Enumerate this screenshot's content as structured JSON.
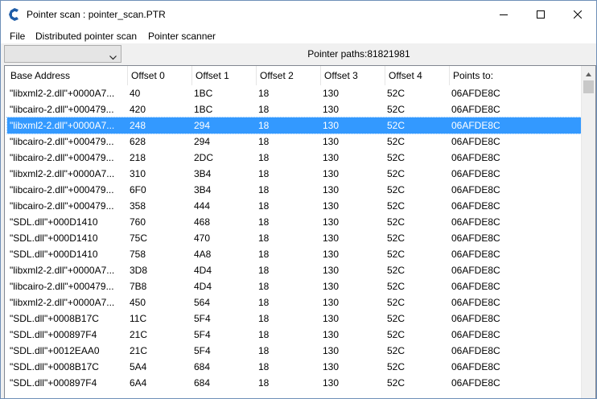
{
  "window": {
    "title": "Pointer scan : pointer_scan.PTR"
  },
  "menu": {
    "items": [
      "File",
      "Distributed pointer scan",
      "Pointer scanner"
    ]
  },
  "toolbar": {
    "combo_value": "",
    "pointer_paths": "Pointer paths:81821981"
  },
  "table": {
    "columns": [
      "Base Address",
      "Offset 0",
      "Offset 1",
      "Offset 2",
      "Offset 3",
      "Offset 4",
      "Points to:"
    ],
    "selected_index": 2,
    "rows": [
      [
        "\"libxml2-2.dll\"+0000A7...",
        "40",
        "1BC",
        "18",
        "130",
        "52C",
        "06AFDE8C"
      ],
      [
        "\"libcairo-2.dll\"+000479...",
        "420",
        "1BC",
        "18",
        "130",
        "52C",
        "06AFDE8C"
      ],
      [
        "\"libxml2-2.dll\"+0000A7...",
        "248",
        "294",
        "18",
        "130",
        "52C",
        "06AFDE8C"
      ],
      [
        "\"libcairo-2.dll\"+000479...",
        "628",
        "294",
        "18",
        "130",
        "52C",
        "06AFDE8C"
      ],
      [
        "\"libcairo-2.dll\"+000479...",
        "218",
        "2DC",
        "18",
        "130",
        "52C",
        "06AFDE8C"
      ],
      [
        "\"libxml2-2.dll\"+0000A7...",
        "310",
        "3B4",
        "18",
        "130",
        "52C",
        "06AFDE8C"
      ],
      [
        "\"libcairo-2.dll\"+000479...",
        "6F0",
        "3B4",
        "18",
        "130",
        "52C",
        "06AFDE8C"
      ],
      [
        "\"libcairo-2.dll\"+000479...",
        "358",
        "444",
        "18",
        "130",
        "52C",
        "06AFDE8C"
      ],
      [
        "\"SDL.dll\"+000D1410",
        "760",
        "468",
        "18",
        "130",
        "52C",
        "06AFDE8C"
      ],
      [
        "\"SDL.dll\"+000D1410",
        "75C",
        "470",
        "18",
        "130",
        "52C",
        "06AFDE8C"
      ],
      [
        "\"SDL.dll\"+000D1410",
        "758",
        "4A8",
        "18",
        "130",
        "52C",
        "06AFDE8C"
      ],
      [
        "\"libxml2-2.dll\"+0000A7...",
        "3D8",
        "4D4",
        "18",
        "130",
        "52C",
        "06AFDE8C"
      ],
      [
        "\"libcairo-2.dll\"+000479...",
        "7B8",
        "4D4",
        "18",
        "130",
        "52C",
        "06AFDE8C"
      ],
      [
        "\"libxml2-2.dll\"+0000A7...",
        "450",
        "564",
        "18",
        "130",
        "52C",
        "06AFDE8C"
      ],
      [
        "\"SDL.dll\"+0008B17C",
        "11C",
        "5F4",
        "18",
        "130",
        "52C",
        "06AFDE8C"
      ],
      [
        "\"SDL.dll\"+000897F4",
        "21C",
        "5F4",
        "18",
        "130",
        "52C",
        "06AFDE8C"
      ],
      [
        "\"SDL.dll\"+0012EAA0",
        "21C",
        "5F4",
        "18",
        "130",
        "52C",
        "06AFDE8C"
      ],
      [
        "\"SDL.dll\"+0008B17C",
        "5A4",
        "684",
        "18",
        "130",
        "52C",
        "06AFDE8C"
      ],
      [
        "\"SDL.dll\"+000897F4",
        "6A4",
        "684",
        "18",
        "130",
        "52C",
        "06AFDE8C"
      ]
    ]
  },
  "icons": {
    "app": "cheat-engine-icon",
    "minimize": "minimize-icon",
    "maximize": "maximize-icon",
    "close": "close-icon",
    "combo": "chevron-down-icon",
    "scroll_up": "scroll-up-arrow-icon"
  },
  "colors": {
    "selection": "#3399ff",
    "app_icon_blue": "#1f5da8"
  }
}
